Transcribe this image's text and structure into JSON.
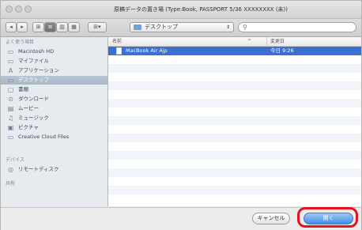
{
  "window": {
    "title": "原稿データの置き場 (Type:Book, PASSPORT 5/36 XXXXXXXX (未))"
  },
  "toolbar": {
    "back_glyph": "◂",
    "forward_glyph": "▸",
    "view_buttons": [
      "⊞",
      "≡",
      "▥",
      "▦"
    ],
    "arrange_glyph": "⊞▾",
    "location_label": "デスクトップ",
    "location_arrows": "⇕",
    "search_placeholder": ""
  },
  "sidebar": {
    "devices_heading": "よく使う項目",
    "items": [
      {
        "icon": "▭",
        "label": "Macintosh HD"
      },
      {
        "icon": "▭",
        "label": "マイファイル"
      },
      {
        "icon": "A",
        "label": "アプリケーション"
      },
      {
        "icon": "▭",
        "label": "デスクトップ",
        "selected": true
      },
      {
        "icon": "▢",
        "label": "書類"
      },
      {
        "icon": "⊙",
        "label": "ダウンロード"
      },
      {
        "icon": "▤",
        "label": "ムービー"
      },
      {
        "icon": "♫",
        "label": "ミュージック"
      },
      {
        "icon": "▣",
        "label": "ピクチャ"
      },
      {
        "icon": "▭",
        "label": "Creative Cloud Files"
      }
    ],
    "shared_heading": "デバイス",
    "shared_items": [
      {
        "icon": "◎",
        "label": "リモートディスク"
      }
    ],
    "tags_heading": "共有"
  },
  "filelist": {
    "col_name": "名前",
    "col_sort": "^",
    "col_date": "変更日",
    "rows": [
      {
        "name": "MacBook Air Ajp",
        "date": "今日 9:26",
        "selected": true
      }
    ]
  },
  "footer": {
    "cancel_label": "キャンセル",
    "open_label": "開く"
  },
  "colors": {
    "selection": "#3b6fd0",
    "highlight": "#e3151a",
    "primary_button": "#3f8ee6"
  }
}
